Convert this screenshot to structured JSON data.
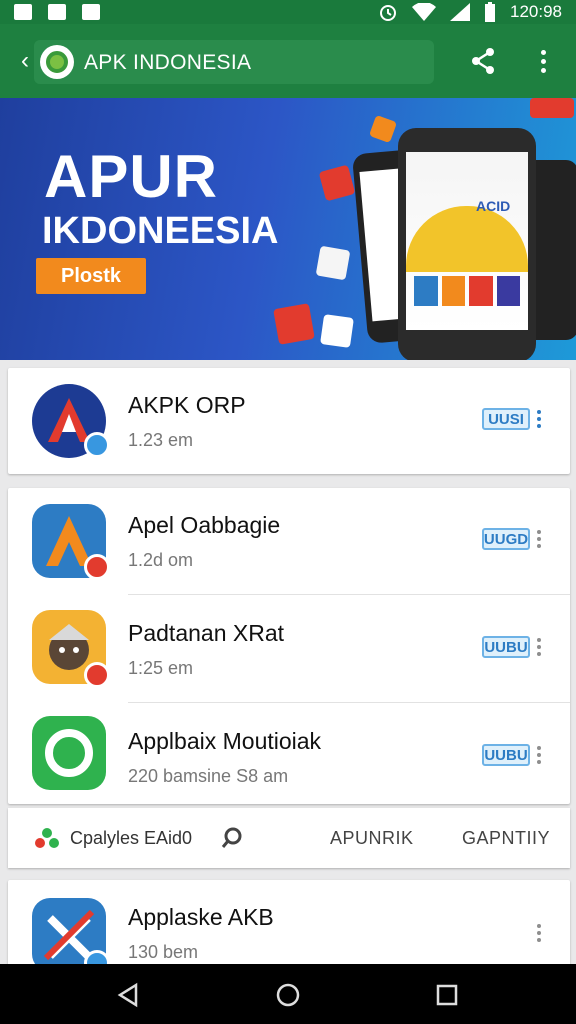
{
  "status_bar": {
    "time": "120:98"
  },
  "app_bar": {
    "title": "APK INDONESIA"
  },
  "banner": {
    "headline": "APUR",
    "subline": "IKDONEESIA",
    "button_label": "Plostk",
    "phone_label": "ACID"
  },
  "featured": {
    "name": "AKPK ORP",
    "size": "1.23 em",
    "action": "UUSI"
  },
  "apps": [
    {
      "name": "Apel Oabbagie",
      "size": "1.2d om",
      "action": "UUGD"
    },
    {
      "name": "Padtanan XRat",
      "size": "1:25 em",
      "action": "UUBU"
    },
    {
      "name": "Applbaix Moutioiak",
      "size": "220 bamsine S8 am",
      "action": "UUBU"
    }
  ],
  "tabs_bar": {
    "left_label": "Cpalyles EAid0",
    "tab1": "APUNRIK",
    "tab2": "GAPNTIIY"
  },
  "last_app": {
    "name": "Applaske AKB",
    "size": "130 bem"
  },
  "colors": {
    "green": "#1e8040",
    "status_green": "#1a7a3c",
    "accent_blue": "#2d7cc4",
    "orange": "#f28a1d"
  },
  "icons": [
    "back-arrow-icon",
    "share-icon",
    "more-vert-icon",
    "search-icon",
    "wifi-icon",
    "signal-icon",
    "battery-icon"
  ]
}
